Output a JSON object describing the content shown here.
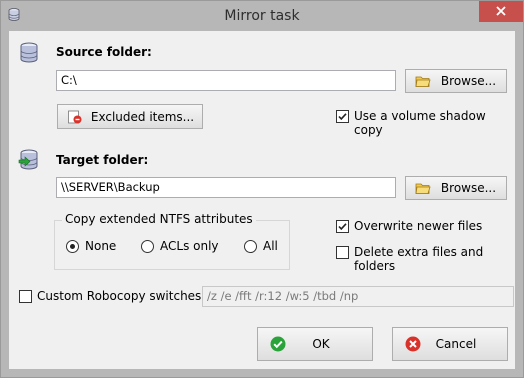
{
  "window": {
    "title": "Mirror task"
  },
  "source": {
    "label": "Source folder:",
    "path": "C:\\",
    "browse_label": "Browse...",
    "excluded_label": "Excluded items...",
    "shadow_copy_label": "Use a volume shadow copy",
    "shadow_copy_checked": true
  },
  "target": {
    "label": "Target folder:",
    "path": "\\\\SERVER\\Backup",
    "browse_label": "Browse..."
  },
  "ntfs": {
    "legend": "Copy extended NTFS attributes",
    "options": [
      "None",
      "ACLs only",
      "All"
    ],
    "selected": "None"
  },
  "options": {
    "overwrite_label": "Overwrite newer files",
    "overwrite_checked": true,
    "delete_label": "Delete extra files and folders",
    "delete_checked": false
  },
  "robocopy": {
    "label": "Custom Robocopy switches:",
    "checked": false,
    "placeholder": "/z /e /fft /r:12 /w:5 /tbd /np"
  },
  "buttons": {
    "ok": "OK",
    "cancel": "Cancel"
  },
  "colors": {
    "chrome": "#b7b7b7",
    "close": "#c7504d",
    "ok": "#2aa33b",
    "cancel": "#d9322b"
  }
}
